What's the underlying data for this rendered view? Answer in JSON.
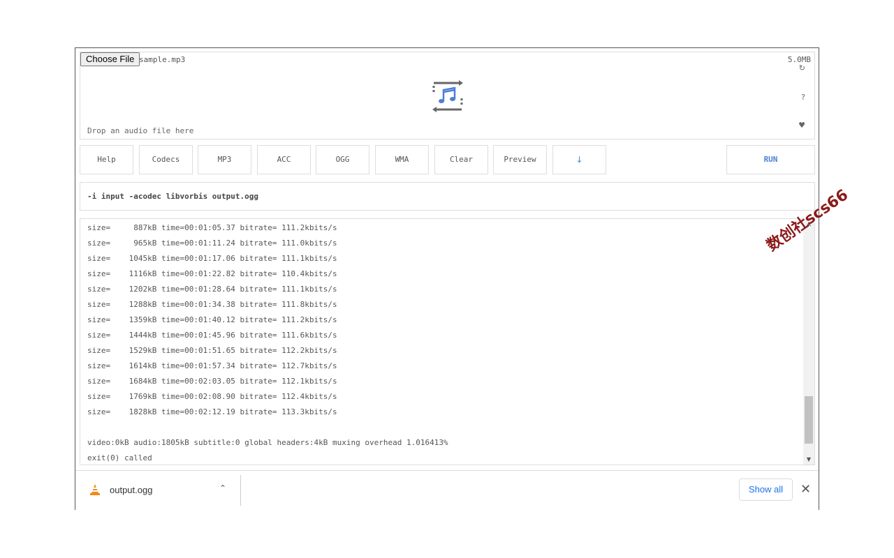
{
  "upload": {
    "choose_label": "Choose File",
    "file_name": "sample.mp3",
    "file_size": "5.0MB",
    "drop_hint": "Drop an audio file here",
    "side_icons": [
      "refresh-icon",
      "question-icon",
      "heart-icon"
    ]
  },
  "toolbar": {
    "buttons": [
      "Help",
      "Codecs",
      "MP3",
      "ACC",
      "OGG",
      "WMA",
      "Clear",
      "Preview"
    ],
    "download_icon": "↓",
    "run_label": "RUN"
  },
  "command": "-i input -acodec libvorbis output.ogg",
  "log": {
    "lines": [
      "size=     887kB time=00:01:05.37 bitrate= 111.2kbits/s",
      "size=     965kB time=00:01:11.24 bitrate= 111.0kbits/s",
      "size=    1045kB time=00:01:17.06 bitrate= 111.1kbits/s",
      "size=    1116kB time=00:01:22.82 bitrate= 110.4kbits/s",
      "size=    1202kB time=00:01:28.64 bitrate= 111.1kbits/s",
      "size=    1288kB time=00:01:34.38 bitrate= 111.8kbits/s",
      "size=    1359kB time=00:01:40.12 bitrate= 111.2kbits/s",
      "size=    1444kB time=00:01:45.96 bitrate= 111.6kbits/s",
      "size=    1529kB time=00:01:51.65 bitrate= 112.2kbits/s",
      "size=    1614kB time=00:01:57.34 bitrate= 112.7kbits/s",
      "size=    1684kB time=00:02:03.05 bitrate= 112.1kbits/s",
      "size=    1769kB time=00:02:08.90 bitrate= 112.4kbits/s",
      "size=    1828kB time=00:02:12.19 bitrate= 113.3kbits/s",
      "",
      "video:0kB audio:1805kB subtitle:0 global headers:4kB muxing overhead 1.016413%",
      "exit(0) called"
    ]
  },
  "downloads": {
    "file_name": "output.ogg",
    "show_all_label": "Show all",
    "close_glyph": "✕",
    "chevron_glyph": "⌃"
  },
  "watermark": "数创社scs66",
  "colors": {
    "accent": "#4a7fd6",
    "link": "#1a73e8",
    "watermark": "#8b1a1a"
  }
}
